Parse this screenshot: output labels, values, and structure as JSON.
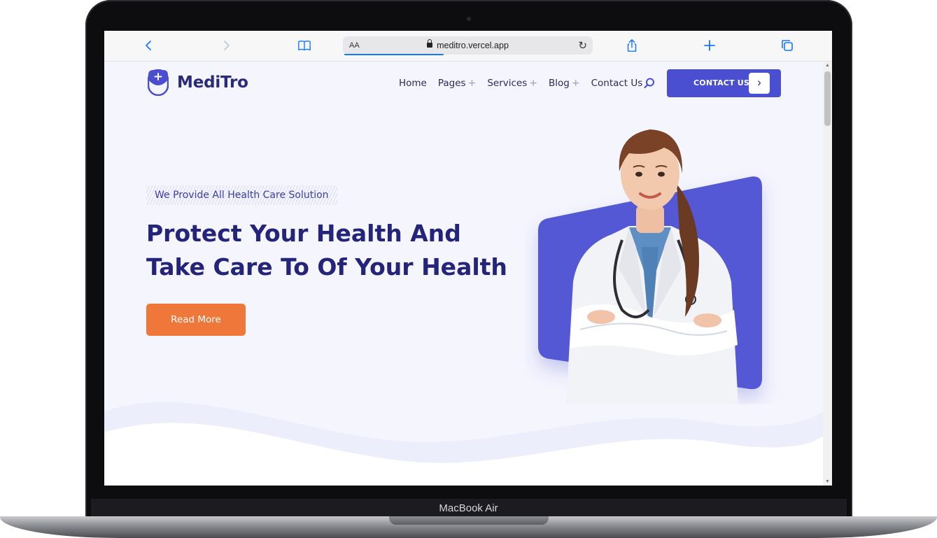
{
  "device": {
    "model_label": "MacBook Air"
  },
  "browser": {
    "text_size_label": "AA",
    "url": "meditro.vercel.app"
  },
  "site": {
    "brand": "MediTro",
    "nav": [
      {
        "label": "Home",
        "has_submenu": false
      },
      {
        "label": "Pages",
        "has_submenu": true
      },
      {
        "label": "Services",
        "has_submenu": true
      },
      {
        "label": "Blog",
        "has_submenu": true
      },
      {
        "label": "Contact Us",
        "has_submenu": false
      }
    ],
    "submenu_indicator": "+",
    "contact_button": "CONTACT US",
    "contact_button_arrow": "›"
  },
  "hero": {
    "tagline": "We Provide All Health Care Solution",
    "headline": "Protect Your Health And Take Care To Of Your Health",
    "cta": "Read More"
  },
  "colors": {
    "primary": "#4a4ed0",
    "accent": "#f0773a",
    "heading": "#24247a",
    "page_bg": "#f4f5fd"
  },
  "icons": [
    "back-arrow-icon",
    "forward-arrow-icon",
    "book-icon",
    "lock-icon",
    "reload-icon",
    "share-icon",
    "plus-icon",
    "tabs-icon",
    "search-icon",
    "chevron-right-icon"
  ]
}
